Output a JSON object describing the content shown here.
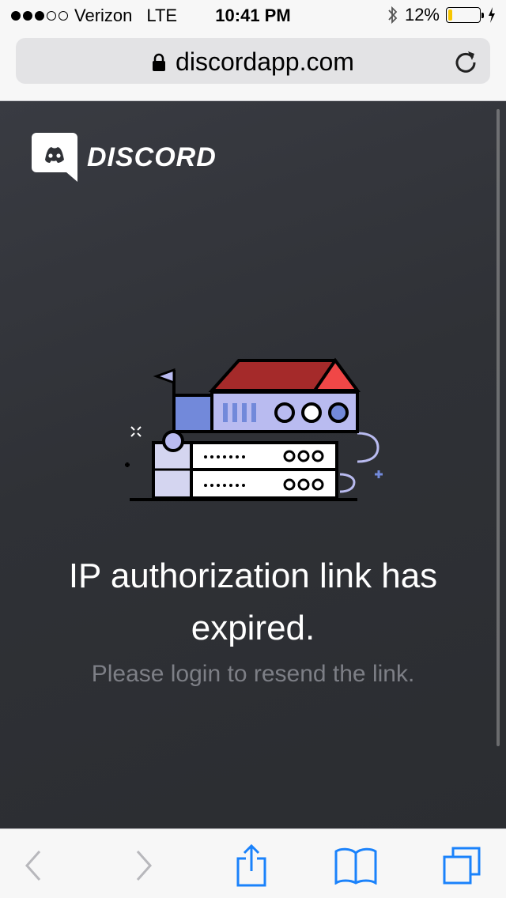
{
  "status_bar": {
    "carrier": "Verizon",
    "network": "LTE",
    "time": "10:41 PM",
    "battery_percent": "12%",
    "battery_level": 0.12,
    "signal_bars_filled": 3,
    "signal_bars_total": 5
  },
  "address_bar": {
    "url": "discordapp.com",
    "lock_icon": "lock-icon",
    "reload_icon": "reload-icon"
  },
  "page": {
    "brand": "DISCORD",
    "headline": "IP authorization link has expired.",
    "subtext": "Please login to resend the link."
  },
  "toolbar": {
    "back_icon": "back-chevron-icon",
    "forward_icon": "forward-chevron-icon",
    "share_icon": "share-icon",
    "bookmarks_icon": "bookmarks-icon",
    "tabs_icon": "tabs-icon"
  },
  "colors": {
    "page_bg": "#2f3136",
    "accent_blue": "#1a82fb",
    "headline": "#ffffff",
    "subtext": "#7d7f86",
    "house_roof": "#a52a2a",
    "house_roof_light": "#f04747",
    "server_purple": "#7289da",
    "server_light": "#b9bbf0"
  }
}
